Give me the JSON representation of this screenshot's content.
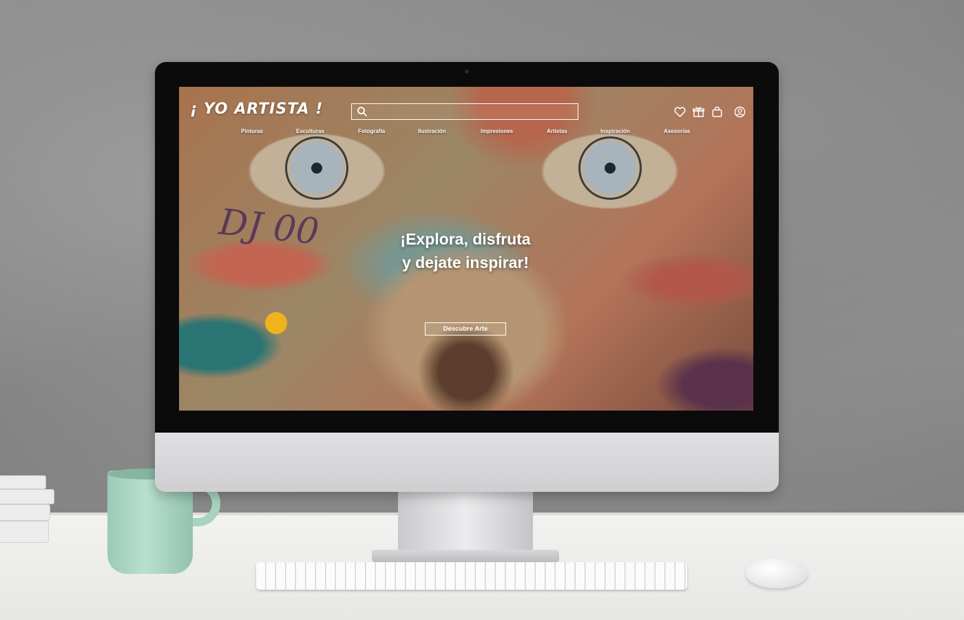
{
  "brand": {
    "logo": "¡ YO ARTISTA !"
  },
  "search": {
    "placeholder": "",
    "value": ""
  },
  "header_icons": [
    "heart-icon",
    "gift-icon",
    "shopping-bag-icon",
    "user-account-icon"
  ],
  "nav": {
    "items": [
      "Pinturas",
      "Esculturas",
      "Fotografía",
      "Ilustración",
      "Impresiones",
      "Artistas",
      "Inspiración",
      "Asesorías"
    ]
  },
  "hero": {
    "title_line1": "¡Explora, disfruta",
    "title_line2": "y dejate inspirar!",
    "cta_label": "Descubre Arte"
  },
  "artwork": {
    "graffiti_text": "DJ 00"
  },
  "colors": {
    "text": "#ffffff",
    "accent_dot": "#f1b31c"
  }
}
